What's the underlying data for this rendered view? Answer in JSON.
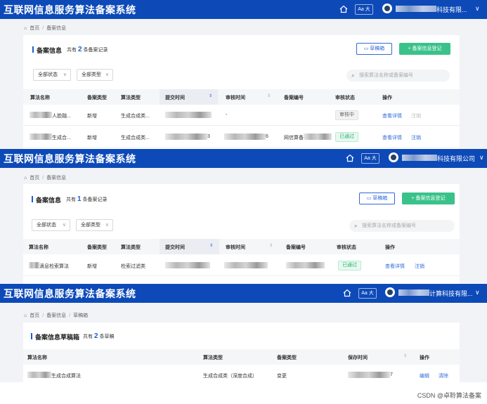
{
  "app_title": "互联网信息服务算法备案系统",
  "lang_label": "Aa 大",
  "panel1": {
    "user_name": "科技有限...",
    "breadcrumb": [
      "首页",
      "备案信息"
    ],
    "card_title": "备案信息",
    "count_prefix": "共有",
    "count_value": "2",
    "count_suffix": "条备案记录",
    "draft_button": "草稿箱",
    "register_button": "+ 备案信息登记",
    "filter_status": "全部状态",
    "filter_type": "全部类型",
    "search_placeholder": "搜索算法名称或备案编号",
    "columns": [
      "算法名称",
      "备案类型",
      "算法类型",
      "提交时间",
      "审核时间",
      "备案编号",
      "审核状态",
      "操作"
    ],
    "rows": [
      {
        "name_suffix": "人脸融...",
        "filing_type": "新增",
        "algo_type": "生成合成类...",
        "submit_time": "",
        "review_time": "-",
        "filing_no": "",
        "status": "审核中",
        "action_view": "查看详情",
        "action_cancel": "注销"
      },
      {
        "name_suffix": "生成合...",
        "filing_type": "新增",
        "algo_type": "生成合成类...",
        "submit_time": "3",
        "review_time": "6",
        "filing_no": "网信算备",
        "status": "已通过",
        "action_view": "查看详情",
        "action_cancel": "注销"
      }
    ]
  },
  "panel2": {
    "user_name": "科技有限公司",
    "breadcrumb": [
      "首页",
      "备案信息"
    ],
    "card_title": "备案信息",
    "count_prefix": "共有",
    "count_value": "1",
    "count_suffix": "条备案记录",
    "draft_button": "草稿箱",
    "register_button": "+ 备案信息登记",
    "filter_status": "全部状态",
    "filter_type": "全部类型",
    "search_placeholder": "搜索算法名称或备案编号",
    "columns": [
      "算法名称",
      "备案类型",
      "算法类型",
      "提交时间",
      "审核时间",
      "备案编号",
      "审核状态",
      "操作"
    ],
    "rows": [
      {
        "name_suffix": "滴息检索算法",
        "filing_type": "新增",
        "algo_type": "检索过滤类",
        "status": "已通过",
        "action_view": "查看详情",
        "action_cancel": "注销"
      }
    ]
  },
  "panel3": {
    "user_name": "计算科技有限...",
    "breadcrumb": [
      "首页",
      "备案信息",
      "草稿箱"
    ],
    "card_title": "备案信息草稿箱",
    "count_prefix": "共有",
    "count_value": "2",
    "count_suffix": "条草稿",
    "columns": [
      "算法名称",
      "算法类型",
      "备案类型",
      "保存时间",
      "操作"
    ],
    "rows": [
      {
        "name_suffix": "生成合成算法",
        "algo_type": "生成合成类（深度合成）",
        "filing_type": "变更",
        "save_time": "7",
        "action_edit": "编辑",
        "action_delete": "清除"
      }
    ]
  },
  "watermark": "CSDN @卓聆算法备案",
  "colors": {
    "header": "#0d4ab8",
    "accent": "#1a5fd6",
    "green_button": "#3ac28a",
    "passed": "#27b36d"
  }
}
